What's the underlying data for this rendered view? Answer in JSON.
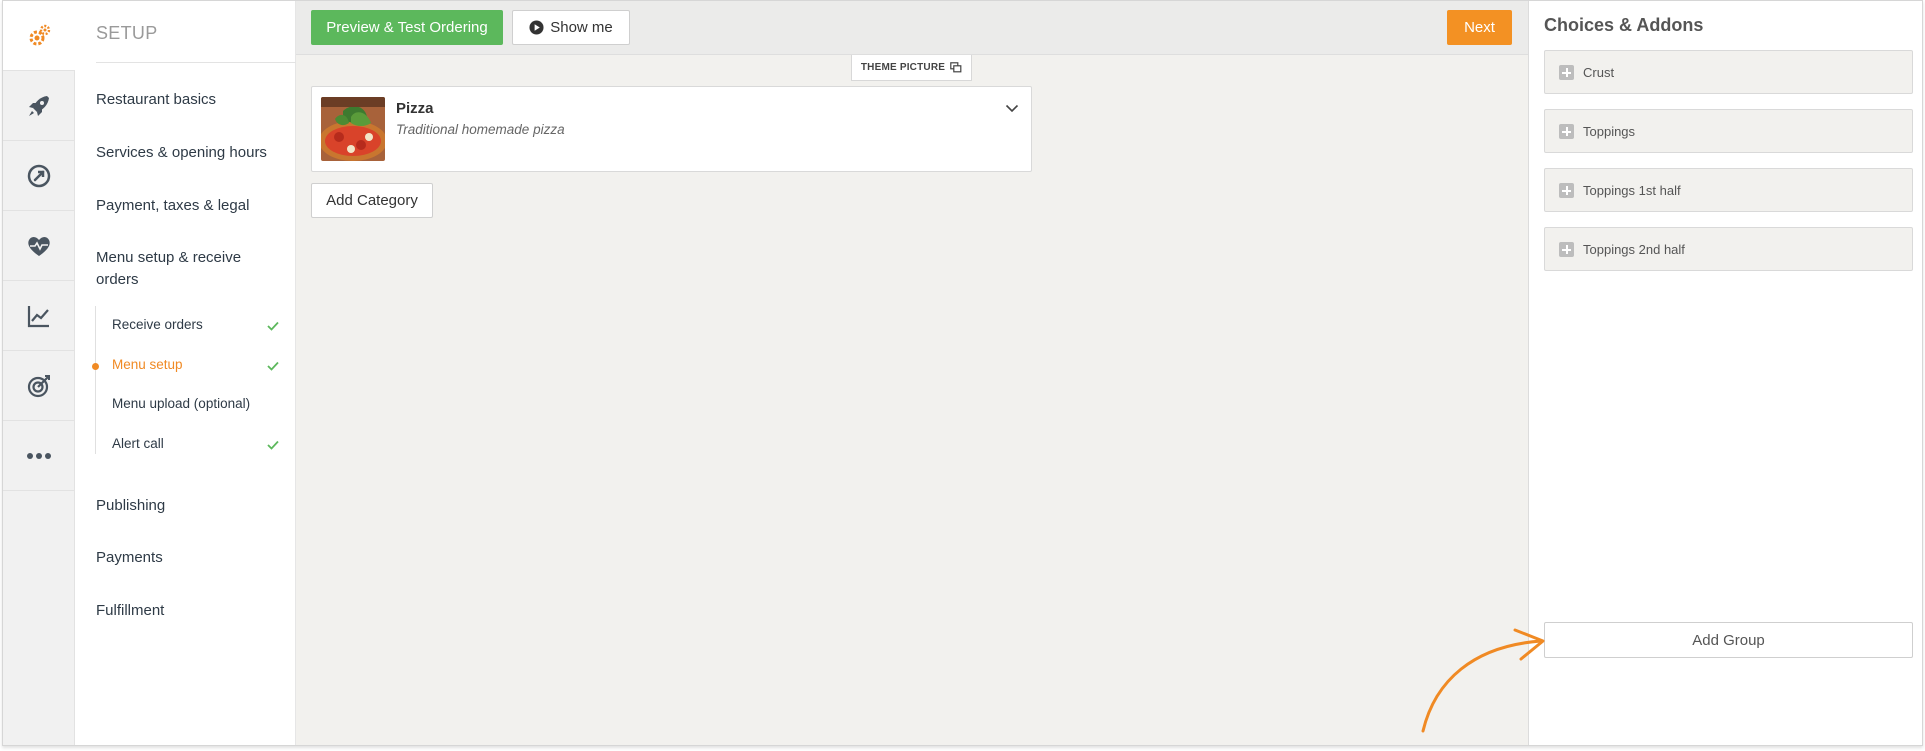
{
  "nav": {
    "title": "SETUP",
    "items": [
      {
        "label": "Restaurant basics"
      },
      {
        "label": "Services & opening hours"
      },
      {
        "label": "Payment, taxes & legal"
      },
      {
        "label": "Menu setup & receive orders"
      },
      {
        "label": "Publishing"
      },
      {
        "label": "Payments"
      },
      {
        "label": "Fulfillment"
      }
    ],
    "sub_items": [
      {
        "label": "Receive orders",
        "checked": true
      },
      {
        "label": "Menu setup",
        "checked": true,
        "active": true
      },
      {
        "label": "Menu upload (optional)",
        "checked": false
      },
      {
        "label": "Alert call",
        "checked": true
      }
    ]
  },
  "rail": {
    "icons": [
      "gears-icon",
      "rocket-icon",
      "dashboard-icon",
      "heart-pulse-icon",
      "chart-icon",
      "target-icon",
      "more-icon"
    ]
  },
  "toolbar": {
    "preview_label": "Preview & Test Ordering",
    "show_me_label": "Show me",
    "next_label": "Next"
  },
  "main": {
    "theme_picture_label": "THEME PICTURE",
    "categories": [
      {
        "name": "Pizza",
        "description": "Traditional homemade pizza"
      }
    ],
    "add_category_label": "Add Category"
  },
  "panel": {
    "title": "Choices & Addons",
    "groups": [
      {
        "label": "Crust"
      },
      {
        "label": "Toppings"
      },
      {
        "label": "Toppings 1st half"
      },
      {
        "label": "Toppings 2nd half"
      }
    ],
    "add_group_label": "Add Group"
  },
  "colors": {
    "accent": "#f39123",
    "green": "#5cb85c",
    "check": "#5cb85c"
  }
}
